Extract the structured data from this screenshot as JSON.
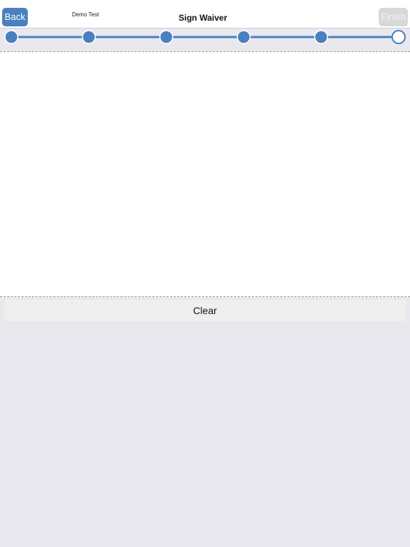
{
  "header": {
    "back_label": "Back",
    "finish_label": "Finish",
    "title": "Sign Waiver",
    "user_name": "Demo Test"
  },
  "progress": {
    "total_steps": 6,
    "completed_steps": 5,
    "active_color": "#4a80c0"
  },
  "signature": {
    "clear_label": "Clear"
  },
  "colors": {
    "accent": "#4a80c0",
    "background": "#e9e8ee",
    "disabled": "#d8d8d8"
  }
}
